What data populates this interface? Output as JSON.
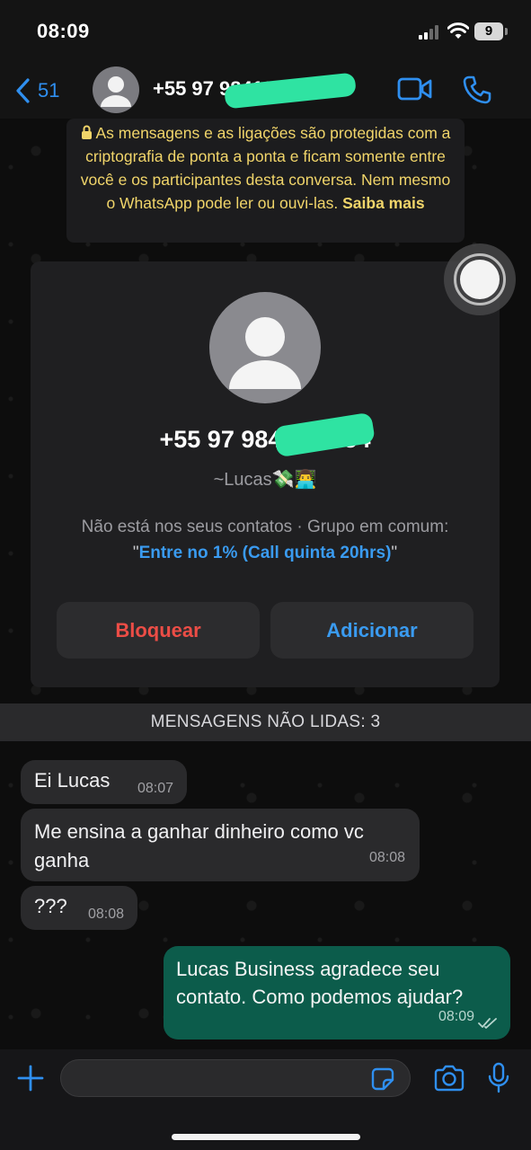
{
  "status_bar": {
    "time": "08:09",
    "battery": "9"
  },
  "header": {
    "back_count": "51",
    "contact_number": "+55 97 98419-1354"
  },
  "notice": {
    "text": "As mensagens e as ligações são protegidas com a criptografia de ponta a ponta e ficam somente entre você e os participantes desta conversa. Nem mesmo o WhatsApp pode ler ou ouvi-las.",
    "link": "Saiba mais"
  },
  "contact_card": {
    "number": "+55 97 98419-1354",
    "nickname": "~Lucas💸👨‍💻",
    "info_prefix": "Não está nos seus contatos · Grupo em comum:",
    "group_name": "Entre no 1% (Call quinta 20hrs)",
    "quote_open": "\"",
    "quote_close": "\"",
    "block_label": "Bloquear",
    "add_label": "Adicionar"
  },
  "unread_banner": "MENSAGENS NÃO LIDAS: 3",
  "messages": [
    {
      "direction": "in",
      "text": "Ei Lucas",
      "time": "08:07"
    },
    {
      "direction": "in",
      "text": "Me ensina a ganhar dinheiro como vc ganha",
      "time": "08:08"
    },
    {
      "direction": "in",
      "text": "???",
      "time": "08:08"
    },
    {
      "direction": "out",
      "text": "Lucas Business agradece seu contato. Como podemos ajudar?",
      "time": "08:09"
    }
  ],
  "colors": {
    "accent_blue": "#2f8ff0",
    "block_red": "#ec4d46",
    "outgoing_bubble": "#0c5c4b",
    "notice_yellow": "#f1d56a",
    "redaction_green": "#2fe3a2"
  },
  "icons": [
    "back-chevron-icon",
    "avatar-placeholder-icon",
    "video-call-icon",
    "phone-icon",
    "lock-icon",
    "plus-icon",
    "sticker-icon",
    "camera-icon",
    "microphone-icon",
    "double-check-icon"
  ],
  "input": {
    "value": "",
    "placeholder": ""
  }
}
